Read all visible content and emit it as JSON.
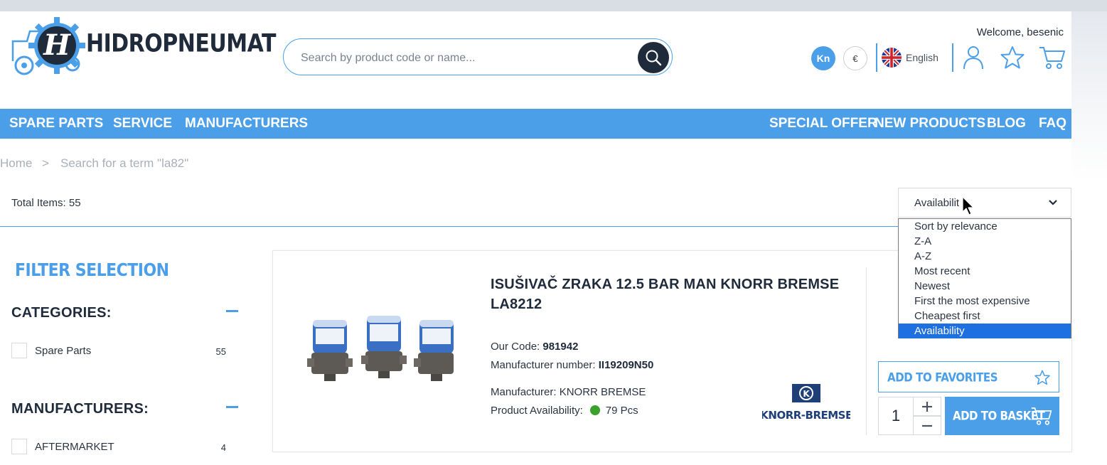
{
  "brand": {
    "name": "HIDROPNEUMAT"
  },
  "header": {
    "search_placeholder": "Search by product code or name...",
    "welcome": "Welcome, besenic",
    "currencies": [
      "Kn",
      "€"
    ],
    "language": "English"
  },
  "nav": {
    "left": [
      "SPARE PARTS",
      "SERVICE",
      "MANUFACTURERS"
    ],
    "right": [
      "SPECIAL OFFER",
      "NEW PRODUCTS",
      "BLOG",
      "FAQ"
    ]
  },
  "breadcrumb": {
    "home": "Home",
    "separator": ">",
    "current": "Search for a term \"la82\""
  },
  "results": {
    "total_label": "Total Items: 55"
  },
  "sort": {
    "selected": "Availabilit",
    "options": [
      "Sort by relevance",
      "Z-A",
      "A-Z",
      "Most recent",
      "Newest",
      "First the most expensive",
      "Cheapest first",
      "Availability"
    ],
    "selected_option": "Availability"
  },
  "filters": {
    "title": "FILTER SELECTION",
    "categories": {
      "heading": "CATEGORIES:",
      "items": [
        {
          "label": "Spare Parts",
          "count": "55"
        }
      ]
    },
    "manufacturers": {
      "heading": "MANUFACTURERS:",
      "items": [
        {
          "label": "AFTERMARKET",
          "count": "4"
        }
      ]
    }
  },
  "product": {
    "title": "ISUŠIVAČ ZRAKA 12.5 BAR MAN KNORR BREMSE LA8212",
    "our_code_label": "Our Code:",
    "our_code": "981942",
    "mfr_number_label": "Manufacturer number:",
    "mfr_number": "II19209N50",
    "manufacturer_label": "Manufacturer:",
    "manufacturer": "KNORR BREMSE",
    "availability_label": "Product Availability:",
    "availability": "79 Pcs",
    "brand_logo_text": "KNORR-BREMSE",
    "add_to_favorites": "ADD TO FAVORITES",
    "quantity": "1",
    "add_to_basket": "ADD TO BASKET"
  },
  "colors": {
    "accent": "#4a9fe8",
    "dark": "#1f2a3a",
    "in_stock": "#3aa12f",
    "selected_option": "#1e6fe0"
  }
}
